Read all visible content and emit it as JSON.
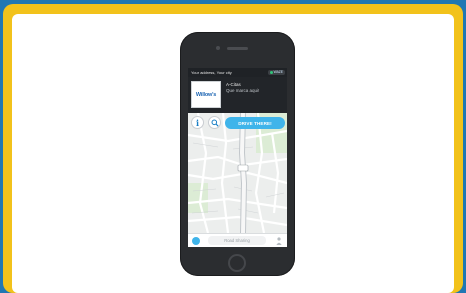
{
  "status_bar": {
    "location": "Your address, Your city",
    "badge": "WAZE"
  },
  "info_card": {
    "logo_text": "Willow's",
    "title": "A-Citas",
    "subtitle": "Que marca aqui!"
  },
  "actions": {
    "info_icon": "i",
    "drive_label": "DRIVE THERE!"
  },
  "bottom_bar": {
    "search_label": "Road Sharing"
  },
  "colors": {
    "frame_blue": "#2077b3",
    "frame_yellow": "#f2c21b",
    "accent": "#3fb4ea",
    "phone_body": "#2b2d30"
  }
}
